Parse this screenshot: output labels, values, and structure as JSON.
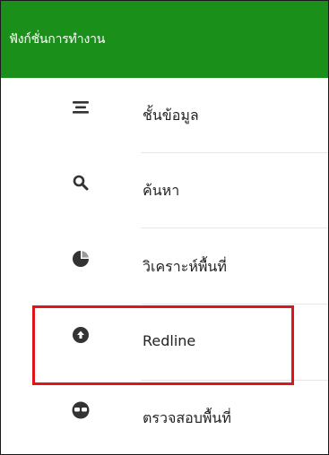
{
  "header": {
    "title": "ฟังก์ชั่นการทำงาน"
  },
  "menu": {
    "items": [
      {
        "label": "ชั้นข้อมูล",
        "icon": "layers-icon"
      },
      {
        "label": "ค้นหา",
        "icon": "search-icon"
      },
      {
        "label": "วิเคราะห์พื้นที่",
        "icon": "pie-chart-icon"
      },
      {
        "label": "Redline",
        "icon": "upload-circle-icon"
      },
      {
        "label": "ตรวจสอบพื้นที่",
        "icon": "inspect-icon"
      }
    ]
  },
  "colors": {
    "header_bg": "#1a8f1a",
    "highlight_border": "#e0151c",
    "icon": "#333333"
  }
}
